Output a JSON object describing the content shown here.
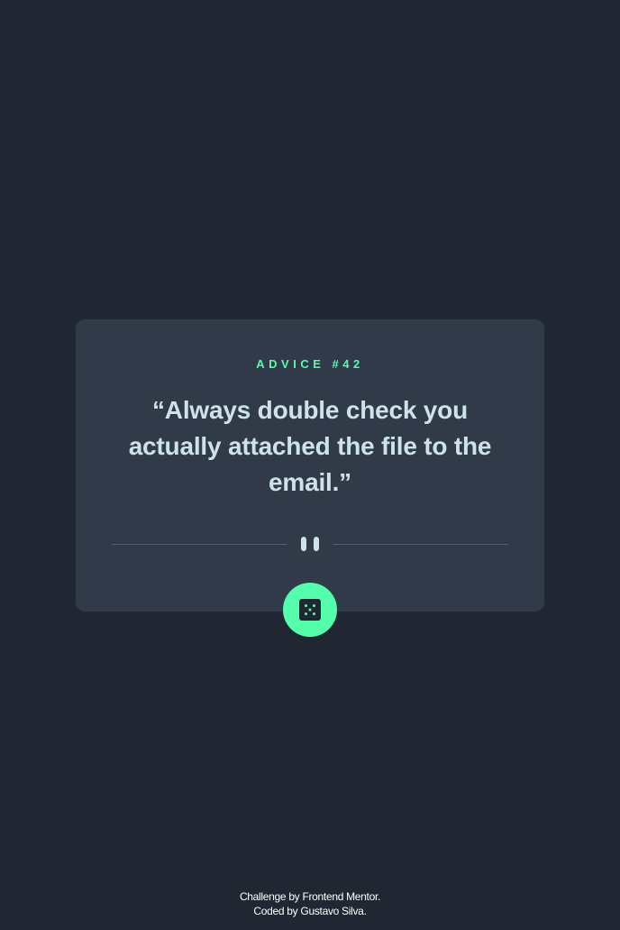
{
  "card": {
    "label_prefix": "ADVICE #",
    "advice_number": "42",
    "advice_text": "“Always double check you actually attached the file to the email.”"
  },
  "icons": {
    "divider": "pause-icon",
    "button": "dice-icon"
  },
  "attribution": {
    "line1_prefix": "Challenge by",
    "line1_link": "Frontend Mentor",
    "line1_suffix": ".",
    "line2_prefix": "Coded by",
    "line2_link": "Gustavo Silva",
    "line2_suffix": "."
  },
  "colors": {
    "background": "#202632",
    "card": "#313a48",
    "accent": "#53ffaa",
    "text": "#cee3e9",
    "divider": "#4f5d74"
  }
}
